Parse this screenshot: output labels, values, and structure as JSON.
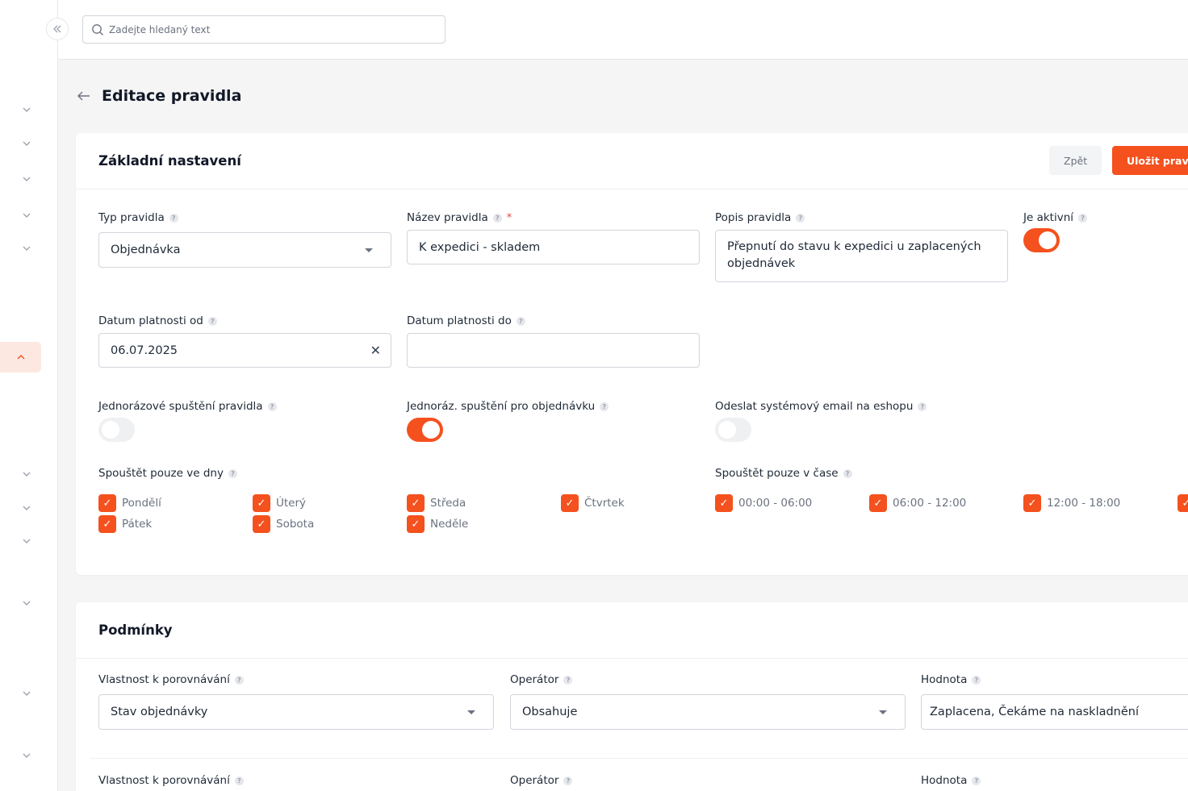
{
  "search": {
    "placeholder": "Zadejte hledaný text"
  },
  "page": {
    "title": "Editace pravidla"
  },
  "basic": {
    "title": "Základní nastavení",
    "back_label": "Zpět",
    "save_label": "Uložit pravidlo",
    "rule_type": {
      "label": "Typ pravidla",
      "value": "Objednávka"
    },
    "rule_name": {
      "label": "Název pravidla",
      "required_mark": "*",
      "value": "K expedici - skladem"
    },
    "rule_desc": {
      "label": "Popis pravidla",
      "value": "Přepnutí do stavu k expedici u zaplacených objednávek"
    },
    "active": {
      "label": "Je aktivní",
      "on": true
    },
    "valid_from": {
      "label": "Datum platnosti od",
      "value": "06.07.2025"
    },
    "valid_to": {
      "label": "Datum platnosti do",
      "value": ""
    },
    "one_time": {
      "label": "Jednorázové spuštění pravidla",
      "on": false
    },
    "one_time_order": {
      "label": "Jednoráz. spuštění pro objednávku",
      "on": true
    },
    "system_email": {
      "label": "Odeslat systémový email na eshopu",
      "on": false
    },
    "days": {
      "label": "Spouštět pouze ve dny",
      "items": [
        "Pondělí",
        "Úterý",
        "Středa",
        "Čtvrtek",
        "Pátek",
        "Sobota",
        "Neděle"
      ]
    },
    "times": {
      "label": "Spouštět pouze v čase",
      "items": [
        "00:00 - 06:00",
        "06:00 - 12:00",
        "12:00 - 18:00"
      ]
    }
  },
  "conditions": {
    "title": "Podmínky",
    "row1": {
      "property_label": "Vlastnost k porovnávání",
      "property_value": "Stav objednávky",
      "operator_label": "Operátor",
      "operator_value": "Obsahuje",
      "value_label": "Hodnota",
      "value_value": "Zaplacena, Čekáme na naskladnění"
    },
    "row2": {
      "property_label": "Vlastnost k porovnávání",
      "operator_label": "Operátor",
      "value_label": "Hodnota"
    }
  },
  "colors": {
    "accent": "#f4511e",
    "accent_light": "#fde8e1"
  }
}
